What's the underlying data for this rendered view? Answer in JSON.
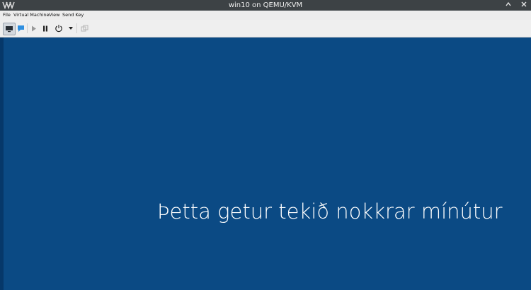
{
  "window": {
    "title": "win10 on QEMU/KVM"
  },
  "menubar": {
    "items": [
      "File",
      "Virtual Machine",
      "View",
      "Send Key"
    ]
  },
  "toolbar": {
    "buttons": [
      "console-view",
      "details-view",
      "run",
      "pause",
      "power",
      "power-menu",
      "snapshots"
    ]
  },
  "guest": {
    "message": "Þetta getur tekið nokkrar mínútur",
    "background_color": "#0b4a84"
  }
}
